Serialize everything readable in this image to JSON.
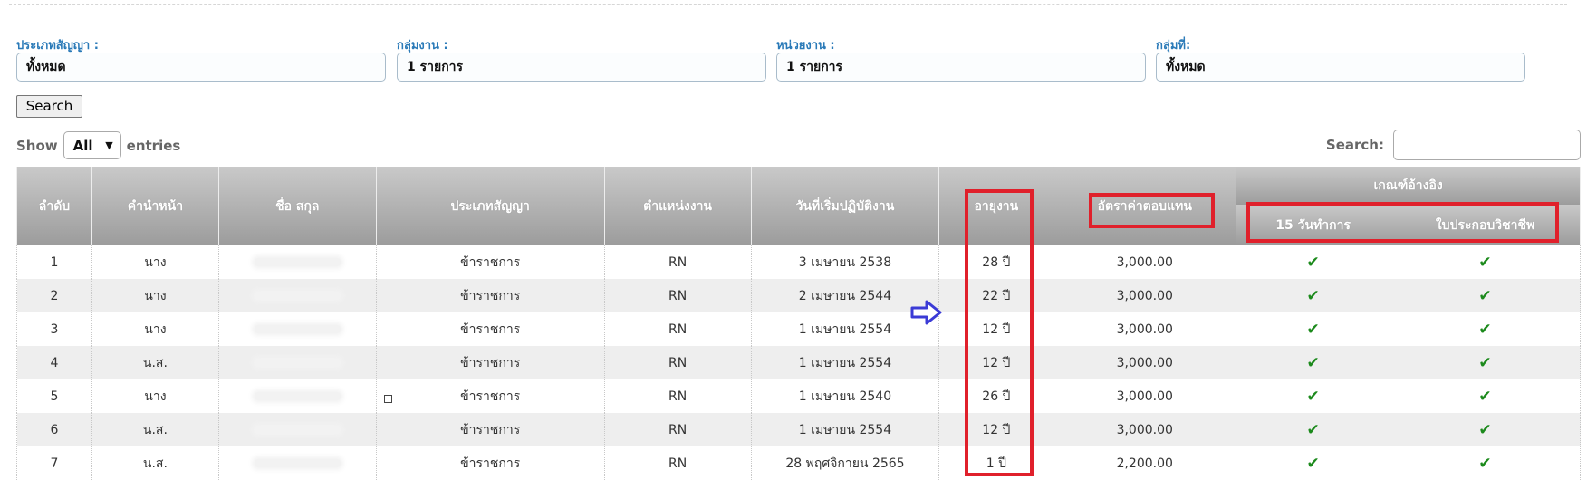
{
  "filters": [
    {
      "label": "ประเภทสัญญา :",
      "value": "ทั้งหมด"
    },
    {
      "label": "กลุ่มงาน :",
      "value": "1 รายการ"
    },
    {
      "label": "หน่วยงาน :",
      "value": "1 รายการ"
    },
    {
      "label": "กลุ่มที่:",
      "value": "ทั้งหมด"
    }
  ],
  "search_button": "Search",
  "show": {
    "prefix": "Show",
    "selected": "All",
    "suffix": "entries"
  },
  "table_search_label": "Search:",
  "table": {
    "headers": [
      "ลำดับ",
      "คำนำหน้า",
      "ชื่อ สกุล",
      "ประเภทสัญญา",
      "ตำแหน่งงาน",
      "วันที่เริ่มปฏิบัติงาน",
      "อายุงาน",
      "อัตราค่าตอบแทน"
    ],
    "group_header": "เกณฑ์อ้างอิง",
    "sub_headers": [
      "15 วันทำการ",
      "ใบประกอบวิชาชีพ"
    ],
    "rows": [
      {
        "no": "1",
        "prefix": "นาง",
        "contract": "ข้าราชการ",
        "position": "RN",
        "start": "3 เมษายน 2538",
        "age": "28 ปี",
        "rate": "3,000.00",
        "c1": "✔",
        "c2": "✔"
      },
      {
        "no": "2",
        "prefix": "นาง",
        "contract": "ข้าราชการ",
        "position": "RN",
        "start": "2 เมษายน 2544",
        "age": "22 ปี",
        "rate": "3,000.00",
        "c1": "✔",
        "c2": "✔"
      },
      {
        "no": "3",
        "prefix": "นาง",
        "contract": "ข้าราชการ",
        "position": "RN",
        "start": "1 เมษายน 2554",
        "age": "12 ปี",
        "rate": "3,000.00",
        "c1": "✔",
        "c2": "✔"
      },
      {
        "no": "4",
        "prefix": "น.ส.",
        "contract": "ข้าราชการ",
        "position": "RN",
        "start": "1 เมษายน 2554",
        "age": "12 ปี",
        "rate": "3,000.00",
        "c1": "✔",
        "c2": "✔"
      },
      {
        "no": "5",
        "prefix": "นาง",
        "contract": "ข้าราชการ",
        "position": "RN",
        "start": "1 เมษายน 2540",
        "age": "26 ปี",
        "rate": "3,000.00",
        "c1": "✔",
        "c2": "✔"
      },
      {
        "no": "6",
        "prefix": "น.ส.",
        "contract": "ข้าราชการ",
        "position": "RN",
        "start": "1 เมษายน 2554",
        "age": "12 ปี",
        "rate": "3,000.00",
        "c1": "✔",
        "c2": "✔"
      },
      {
        "no": "7",
        "prefix": "น.ส.",
        "contract": "ข้าราชการ",
        "position": "RN",
        "start": "28 พฤศจิกายน 2565",
        "age": "1 ปี",
        "rate": "2,200.00",
        "c1": "✔",
        "c2": "✔"
      }
    ]
  },
  "colors": {
    "highlight": "#e0202b",
    "arrow": "#3b3bd6",
    "label_blue": "#2a7ab8",
    "check_green": "#1c8a1c"
  },
  "icons": {
    "select_caret": "chevron-down-icon",
    "check": "check-icon",
    "annotation_arrow": "right-arrow-icon"
  }
}
